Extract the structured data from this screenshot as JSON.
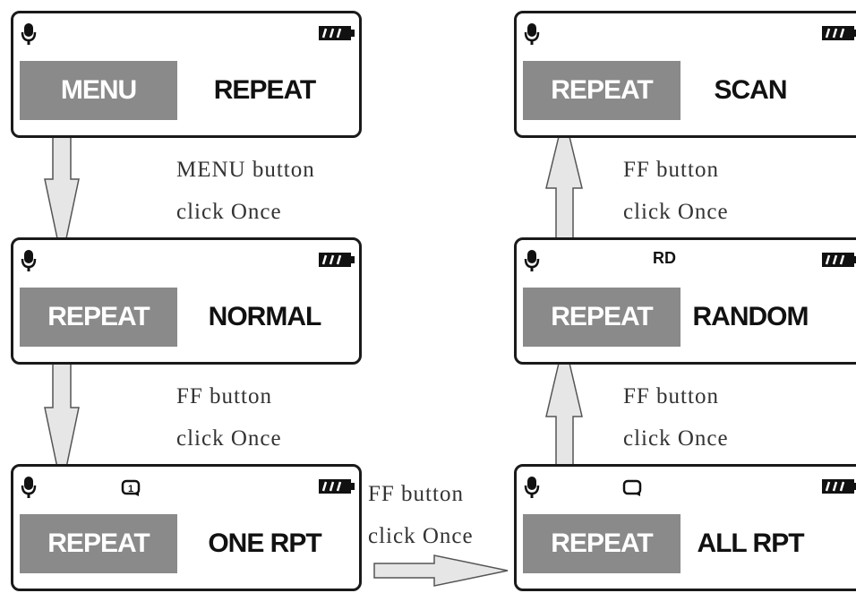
{
  "screens": [
    {
      "id": "s1",
      "highlight": "MENU",
      "value": "REPEAT",
      "status_text": "",
      "status_icon": ""
    },
    {
      "id": "s2",
      "highlight": "REPEAT",
      "value": "NORMAL",
      "status_text": "",
      "status_icon": ""
    },
    {
      "id": "s3",
      "highlight": "REPEAT",
      "value": "ONE RPT",
      "status_text": "",
      "status_icon": "repeat-one-icon"
    },
    {
      "id": "s4",
      "highlight": "REPEAT",
      "value": "ALL RPT",
      "status_text": "",
      "status_icon": "repeat-all-icon"
    },
    {
      "id": "s5",
      "highlight": "REPEAT",
      "value": "RANDOM",
      "status_text": "RD",
      "status_icon": ""
    },
    {
      "id": "s6",
      "highlight": "REPEAT",
      "value": "SCAN",
      "status_text": "",
      "status_icon": ""
    }
  ],
  "steps": [
    {
      "line1": "MENU button",
      "line2": "click Once"
    },
    {
      "line1": "FF button",
      "line2": "click Once"
    },
    {
      "line1": "FF button",
      "line2": "click Once"
    },
    {
      "line1": "FF button",
      "line2": "click Once"
    },
    {
      "line1": "FF button",
      "line2": "click Once"
    }
  ],
  "icons": {
    "mic": "microphone-icon",
    "battery": "battery-icon"
  },
  "colors": {
    "highlight": "#8a8a8a",
    "arrow_fill": "#e6e6e6",
    "border": "#1a1a1a"
  }
}
